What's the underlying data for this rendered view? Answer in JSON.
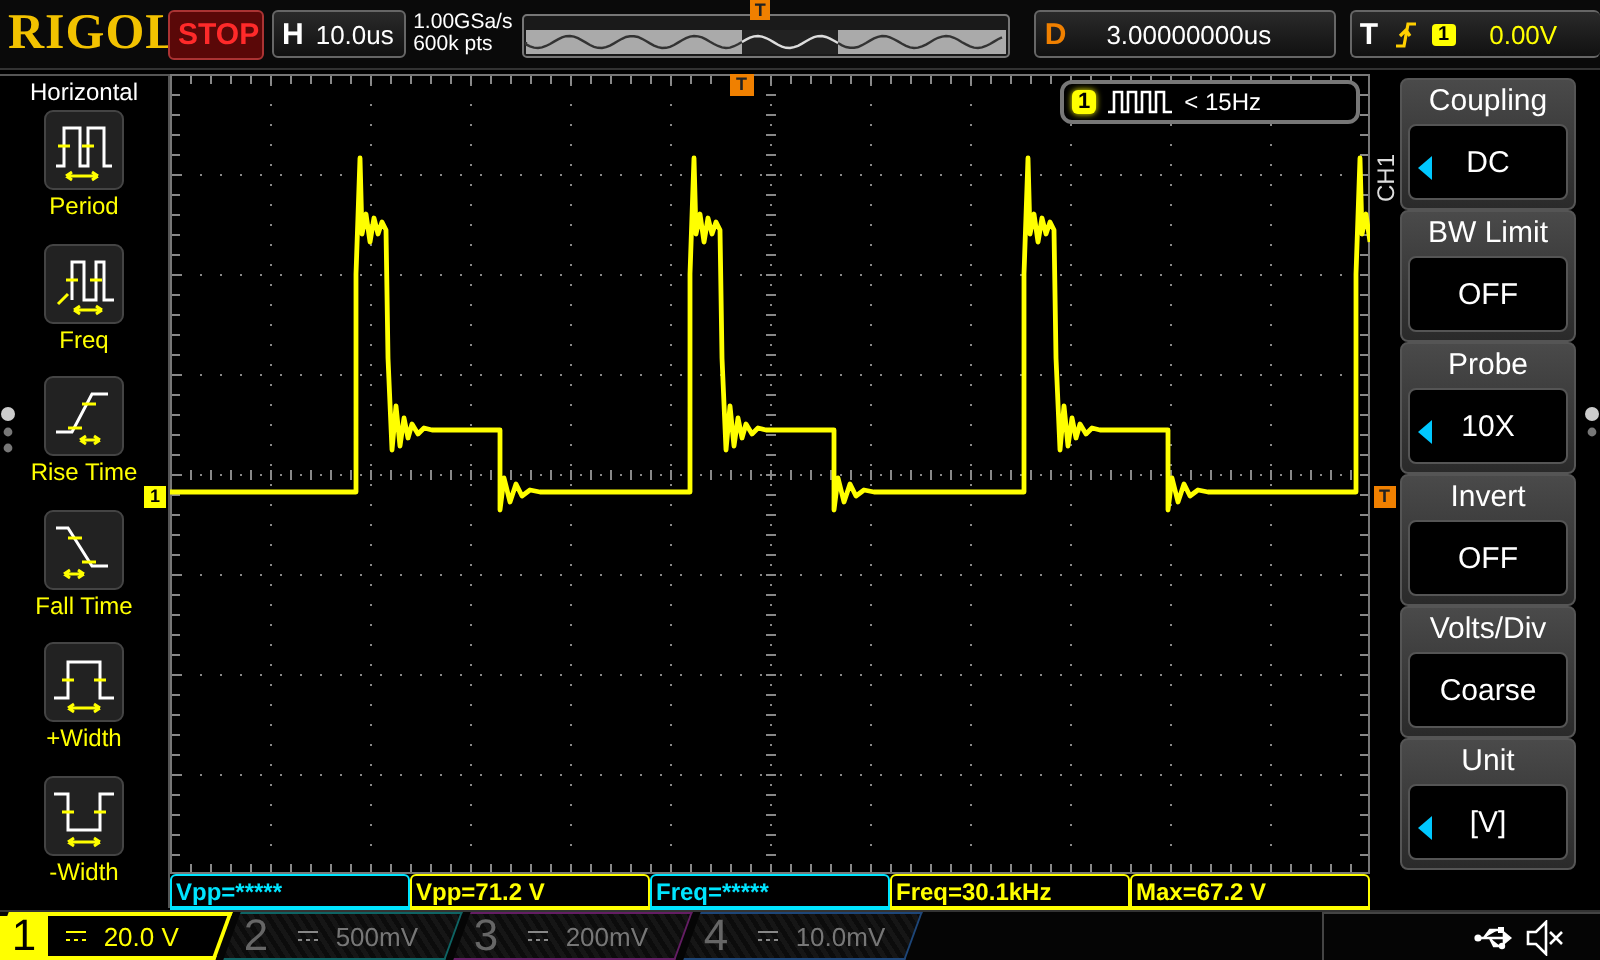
{
  "top_bar": {
    "logo": "RIGOL",
    "run_state": "STOP",
    "timebase": {
      "label": "H",
      "value": "10.0us"
    },
    "sample_rate": "1.00GSa/s",
    "memory_depth": "600k pts",
    "preview_marker": "T",
    "delay": {
      "label": "D",
      "value": "3.00000000us"
    },
    "trigger": {
      "label": "T",
      "source": "1",
      "level": "0.00V"
    }
  },
  "left_menu": {
    "title": "Horizontal",
    "items": [
      {
        "label": "Period"
      },
      {
        "label": "Freq"
      },
      {
        "label": "Rise Time"
      },
      {
        "label": "Fall Time"
      },
      {
        "label": "+Width"
      },
      {
        "label": "-Width"
      }
    ]
  },
  "grid": {
    "trigger_marker": "T",
    "channel_marker": "1",
    "trigger_level_marker": "T"
  },
  "counter": {
    "channel": "1",
    "reading": "< 15Hz"
  },
  "channel_menu": {
    "title": "CH1",
    "items": [
      {
        "label": "Coupling",
        "value": "DC",
        "knob": true
      },
      {
        "label": "BW Limit",
        "value": "OFF",
        "knob": false
      },
      {
        "label": "Probe",
        "value": "10X",
        "knob": true
      },
      {
        "label": "Invert",
        "value": "OFF",
        "knob": false
      },
      {
        "label": "Volts/Div",
        "value": "Coarse",
        "knob": false
      },
      {
        "label": "Unit",
        "value": "[V]",
        "knob": true
      }
    ]
  },
  "measurements": [
    {
      "text": "Vpp=*****",
      "color": "#00e5ff"
    },
    {
      "text": "Vpp=71.2 V",
      "color": "#ffff00"
    },
    {
      "text": "Freq=*****",
      "color": "#00e5ff"
    },
    {
      "text": "Freq=30.1kHz",
      "color": "#ffff00"
    },
    {
      "text": "Max=67.2 V",
      "color": "#ffff00"
    }
  ],
  "channels": [
    {
      "number": "1",
      "scale": "20.0 V",
      "selected": true,
      "color": "#ffff00"
    },
    {
      "number": "2",
      "scale": "500mV",
      "selected": false,
      "color": "#0f6464"
    },
    {
      "number": "3",
      "scale": "200mV",
      "selected": false,
      "color": "#641e64"
    },
    {
      "number": "4",
      "scale": "10.0mV",
      "selected": false,
      "color": "#1e4678"
    }
  ]
}
